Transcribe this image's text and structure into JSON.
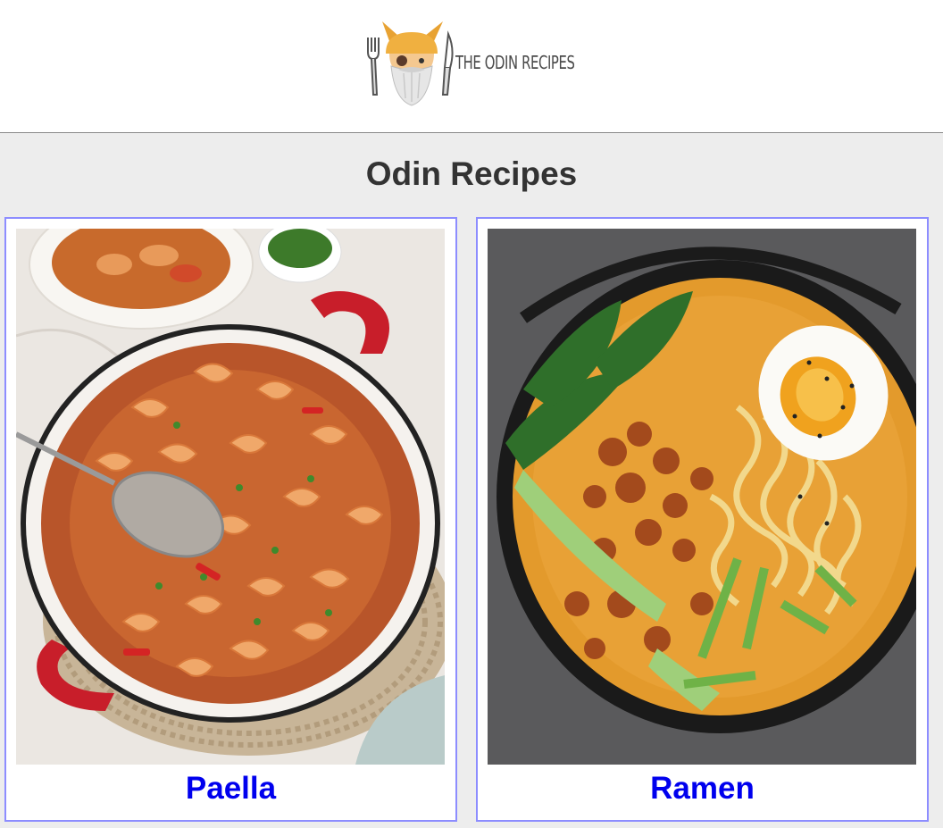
{
  "header": {
    "logo_text": "THE ODIN RECIPES",
    "logo_icon": "viking-chef-logo-icon"
  },
  "main": {
    "title": "Odin Recipes"
  },
  "recipes": [
    {
      "label": "Paella",
      "image": "paella-image"
    },
    {
      "label": "Ramen",
      "image": "ramen-image"
    }
  ],
  "colors": {
    "link": "#0000ee",
    "card_border": "#8d8dff",
    "page_bg": "#ededed"
  }
}
